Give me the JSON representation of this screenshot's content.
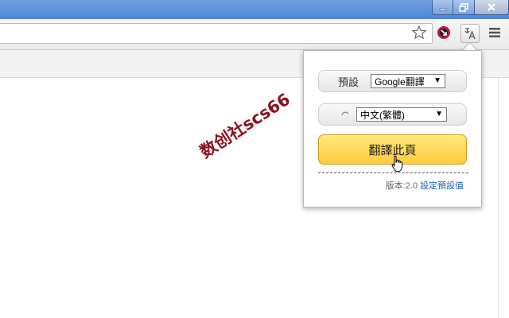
{
  "watermark": "数创社scs66",
  "popup": {
    "default_label": "預設",
    "engine_select": "Google翻譯",
    "language_select": "中文(繁體)",
    "translate_button": "翻譯此頁",
    "version_text": "版本:2.0",
    "settings_link": "設定預設值"
  },
  "colors": {
    "titlebar": "#5b8fdc",
    "button_yellow": "#ffd452",
    "watermark": "#8b1221",
    "link": "#1a5fb4"
  }
}
